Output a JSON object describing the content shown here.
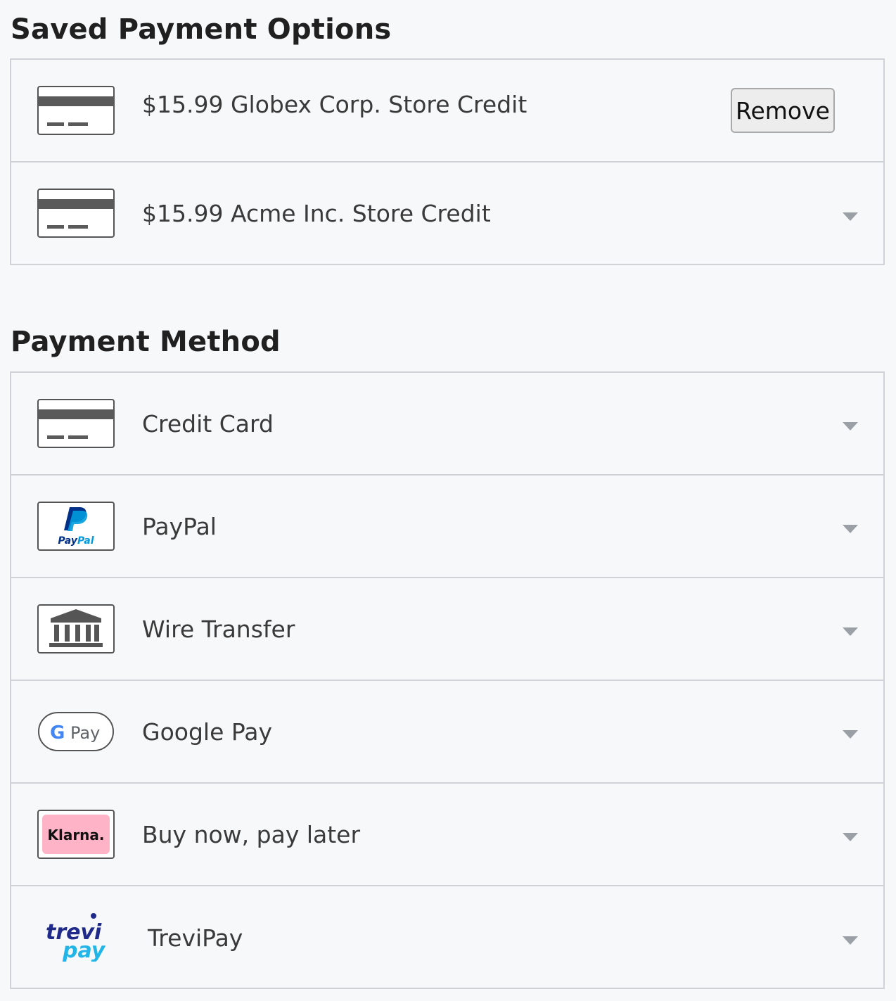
{
  "saved": {
    "title": "Saved Payment Options",
    "items": [
      {
        "label": "$15.99 Globex Corp. Store Credit",
        "icon": "credit-card-icon",
        "action": "Remove"
      },
      {
        "label": "$15.99 Acme Inc. Store Credit",
        "icon": "credit-card-icon"
      }
    ]
  },
  "methods": {
    "title": "Payment Method",
    "items": [
      {
        "label": "Credit Card",
        "icon": "credit-card-icon"
      },
      {
        "label": "PayPal",
        "icon": "paypal-logo-icon",
        "logo_text": "PayPal"
      },
      {
        "label": "Wire Transfer",
        "icon": "bank-icon"
      },
      {
        "label": "Google Pay",
        "icon": "google-pay-logo-icon",
        "logo_text": "G Pay"
      },
      {
        "label": "Buy now, pay later",
        "icon": "klarna-logo-icon",
        "logo_text": "Klarna."
      },
      {
        "label": "TreviPay",
        "icon": "trevipay-logo-icon",
        "logo_text": "trevi pay"
      }
    ]
  },
  "colors": {
    "border": "#cfd2d6",
    "background": "#f7f8fa",
    "chevron": "#9aa0a6",
    "klarna_pink": "#ffb3c7",
    "paypal_dark": "#003087",
    "paypal_light": "#009cde",
    "trevi_dark": "#1f2a8a",
    "trevi_light": "#22b6e8"
  }
}
